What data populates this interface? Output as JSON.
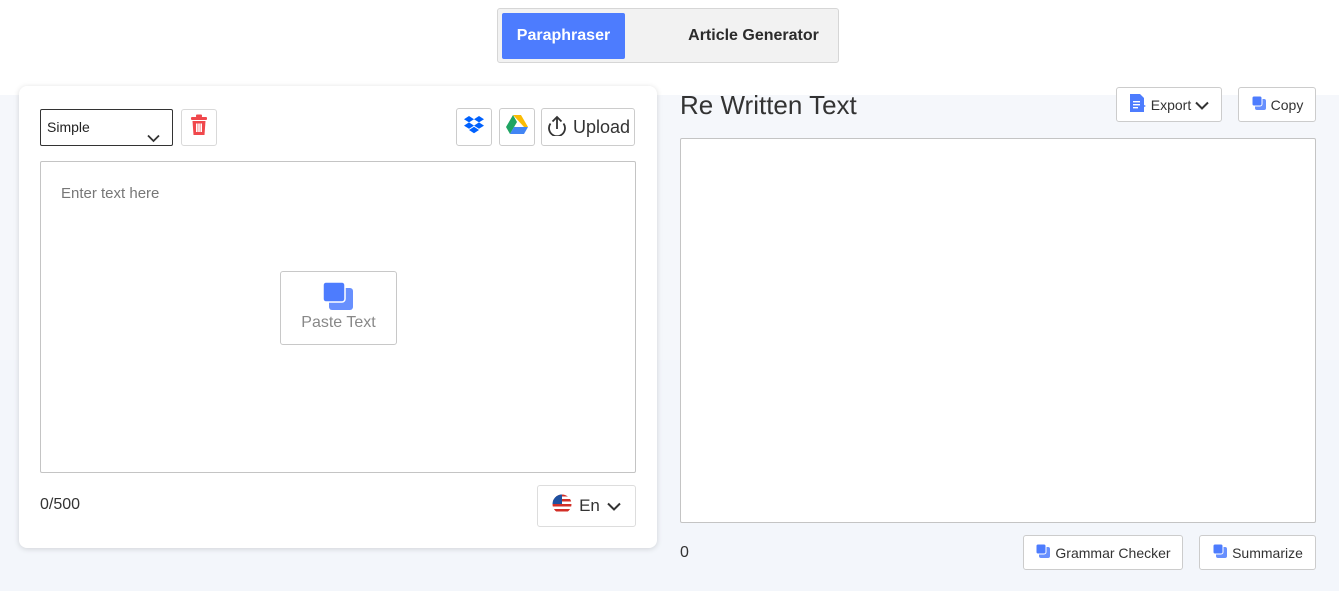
{
  "mode_tabs": {
    "active_label": "Paraphraser",
    "other_label": "Article Generator"
  },
  "input": {
    "mode_select_value": "Simple",
    "placeholder": "Enter text here",
    "paste_label": "Paste Text",
    "upload_label": "Upload",
    "count": "0/500",
    "language": "En"
  },
  "output": {
    "title": "Re Written Text",
    "export_label": "Export",
    "copy_label": "Copy",
    "count": "0",
    "grammar_label": "Grammar Checker",
    "summarize_label": "Summarize"
  },
  "colors": {
    "accent": "#4d7cfe",
    "trash": "#f0484c"
  }
}
